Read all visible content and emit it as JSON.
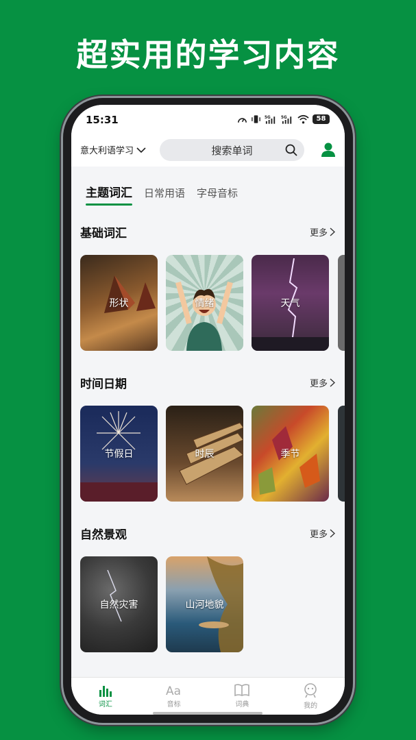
{
  "promo": {
    "title": "超实用的学习内容"
  },
  "status_bar": {
    "time": "15:31",
    "battery": "58",
    "signal1": "5G",
    "signal2": "5G"
  },
  "header": {
    "language": "意大利语学习",
    "search_placeholder": "搜索单词"
  },
  "tabs": [
    {
      "label": "主题词汇",
      "active": true
    },
    {
      "label": "日常用语",
      "active": false
    },
    {
      "label": "字母音标",
      "active": false
    }
  ],
  "sections": [
    {
      "title": "基础词汇",
      "more": "更多",
      "cards": [
        "形状",
        "情绪",
        "天气"
      ]
    },
    {
      "title": "时间日期",
      "more": "更多",
      "cards": [
        "节假日",
        "时辰",
        "季节"
      ]
    },
    {
      "title": "自然景观",
      "more": "更多",
      "cards": [
        "自然灾害",
        "山河地貌"
      ]
    }
  ],
  "bottom_nav": [
    {
      "label": "词汇",
      "icon": "bar-chart-icon",
      "active": true
    },
    {
      "label": "音标",
      "icon": "aa-letters-icon",
      "active": false
    },
    {
      "label": "词典",
      "icon": "book-icon",
      "active": false
    },
    {
      "label": "我的",
      "icon": "profile-icon",
      "active": false
    }
  ],
  "colors": {
    "brand": "#069142",
    "background": "#f4f5f7"
  }
}
